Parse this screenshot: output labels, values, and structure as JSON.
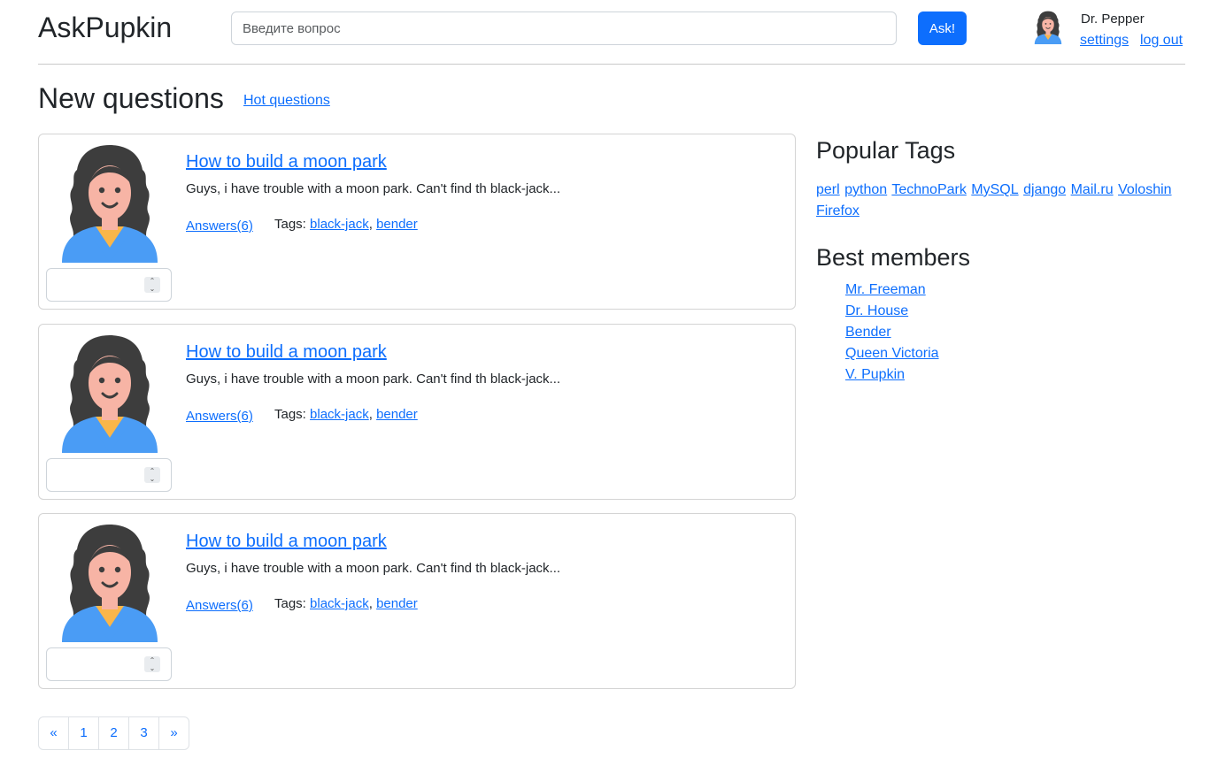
{
  "header": {
    "brand": "AskPupkin",
    "search_placeholder": "Введите вопрос",
    "ask_label": "Ask!",
    "user_name": "Dr. Pepper",
    "settings_label": "settings",
    "logout_label": "log out"
  },
  "main": {
    "title": "New questions",
    "hot_link": "Hot questions",
    "questions": [
      {
        "title": "How to build a moon park",
        "text": "Guys, i have trouble with a moon park. Can't find th black-jack...",
        "answers": "Answers(6)",
        "tags_label": "Tags:",
        "tags": [
          "black-jack",
          "bender"
        ],
        "separator": ","
      },
      {
        "title": "How to build a moon park",
        "text": "Guys, i have trouble with a moon park. Can't find th black-jack...",
        "answers": "Answers(6)",
        "tags_label": "Tags:",
        "tags": [
          "black-jack",
          "bender"
        ],
        "separator": ","
      },
      {
        "title": "How to build a moon park",
        "text": "Guys, i have trouble with a moon park. Can't find th black-jack...",
        "answers": "Answers(6)",
        "tags_label": "Tags:",
        "tags": [
          "black-jack",
          "bender"
        ],
        "separator": ","
      }
    ],
    "pagination": [
      "«",
      "1",
      "2",
      "3",
      "»"
    ]
  },
  "sidebar": {
    "tags_title": "Popular Tags",
    "tags": [
      "perl",
      "python",
      "TechnoPark",
      "MySQL",
      "django",
      "Mail.ru",
      "Voloshin",
      "Firefox"
    ],
    "members_title": "Best members",
    "members": [
      "Mr. Freeman",
      "Dr. House",
      "Bender",
      "Queen Victoria",
      "V. Pupkin"
    ]
  },
  "colors": {
    "accent": "#0d6efd",
    "hair": "#3d3d3d",
    "skin": "#f7b4a5",
    "jacket": "#4a9cf5",
    "shirt": "#f9b64a"
  },
  "icons": {
    "avatar": "woman-avatar-icon",
    "spinner": "spin-arrows-icon"
  }
}
